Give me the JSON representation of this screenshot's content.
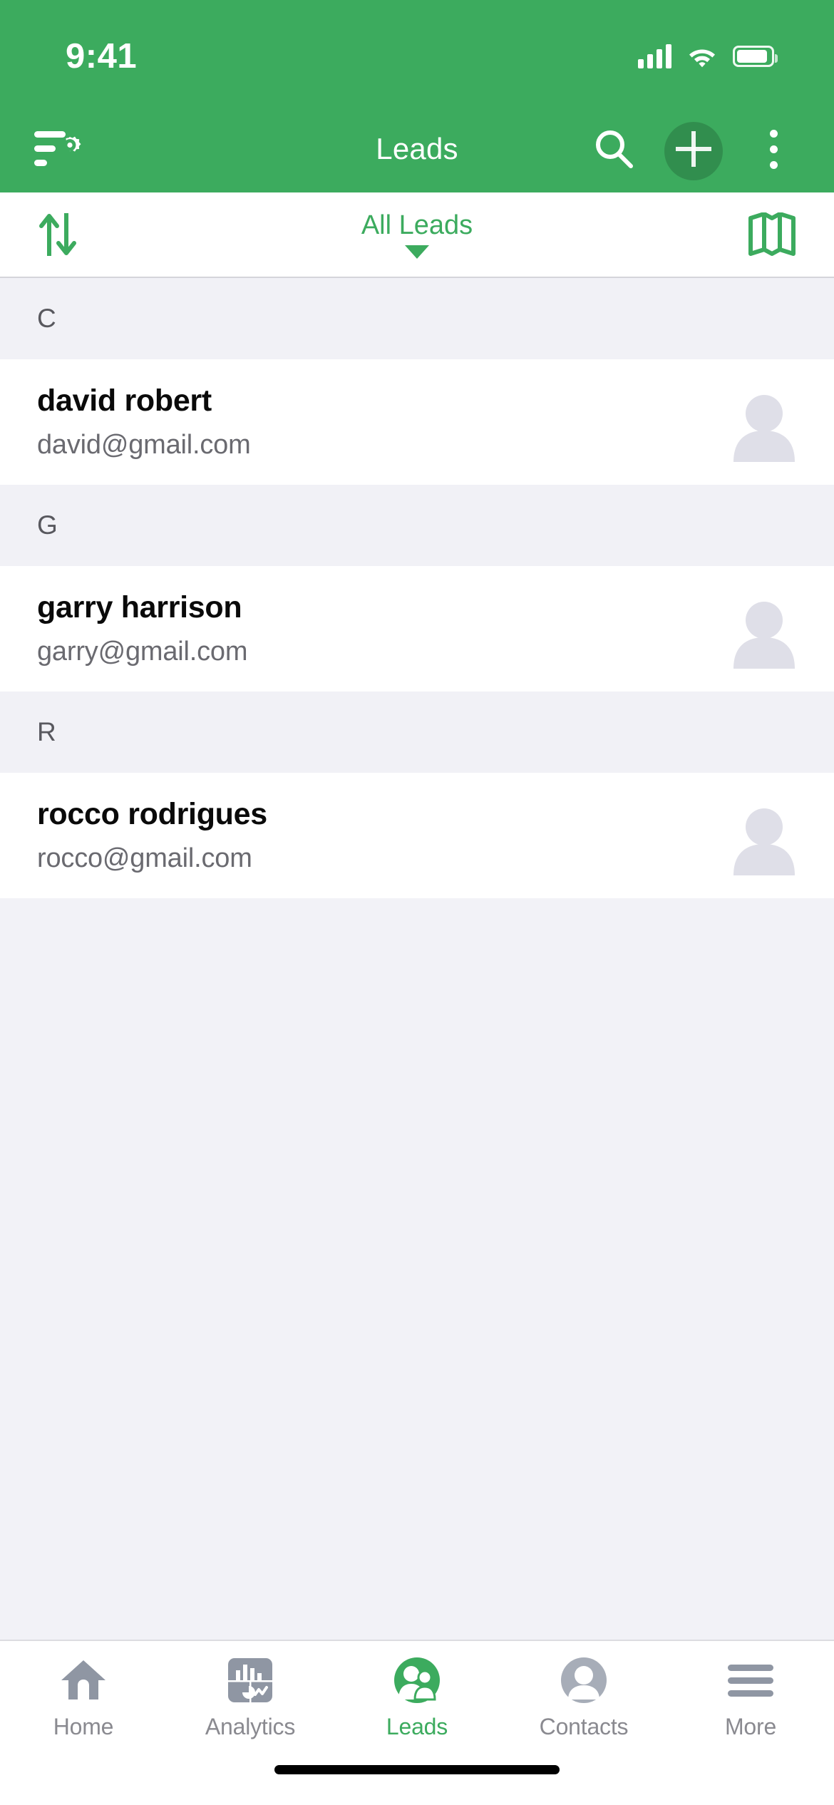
{
  "status_bar": {
    "time": "9:41",
    "signal_icon": "cellular-signal-icon",
    "wifi_icon": "wifi-icon",
    "battery_icon": "battery-icon"
  },
  "app_bar": {
    "title": "Leads",
    "filter_settings_icon": "filter-settings-icon",
    "search_icon": "search-icon",
    "add_icon": "plus-icon",
    "overflow_icon": "more-vertical-icon",
    "background_color": "#3cab5e",
    "title_color": "#ffffff"
  },
  "filter_bar": {
    "sort_icon": "sort-arrows-icon",
    "view_label": "All Leads",
    "dropdown_icon": "caret-down-icon",
    "map_icon": "map-icon",
    "accent_color": "#3cab5e"
  },
  "list": {
    "sections": [
      {
        "letter": "C",
        "items": [
          {
            "name": "david robert",
            "email": "david@gmail.com",
            "avatar_icon": "person-placeholder-avatar"
          }
        ]
      },
      {
        "letter": "G",
        "items": [
          {
            "name": "garry harrison",
            "email": "garry@gmail.com",
            "avatar_icon": "person-placeholder-avatar"
          }
        ]
      },
      {
        "letter": "R",
        "items": [
          {
            "name": "rocco rodrigues",
            "email": "rocco@gmail.com",
            "avatar_icon": "person-placeholder-avatar"
          }
        ]
      }
    ]
  },
  "tab_bar": {
    "active_index": 2,
    "active_color": "#3cab5e",
    "inactive_color": "#8a8a90",
    "tabs": [
      {
        "label": "Home",
        "icon": "home-icon"
      },
      {
        "label": "Analytics",
        "icon": "analytics-chart-icon"
      },
      {
        "label": "Leads",
        "icon": "leads-people-icon"
      },
      {
        "label": "Contacts",
        "icon": "contact-person-icon"
      },
      {
        "label": "More",
        "icon": "hamburger-menu-icon"
      }
    ]
  },
  "home_indicator": {
    "present": true
  }
}
